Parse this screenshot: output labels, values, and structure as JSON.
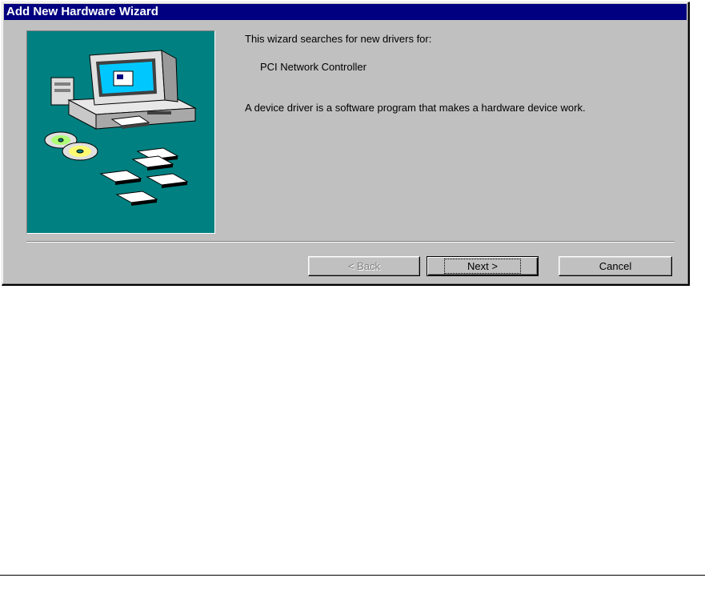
{
  "window": {
    "title": "Add New Hardware Wizard"
  },
  "content": {
    "intro": "This wizard searches for new drivers for:",
    "device_name": "PCI Network Controller",
    "description": "A device driver is a software program that makes a hardware device work."
  },
  "buttons": {
    "back_label": "< Back",
    "next_label": "Next >",
    "cancel_label": "Cancel"
  },
  "colors": {
    "titlebar": "#000080",
    "panel_background": "#008080",
    "dialog_background": "#c0c0c0"
  },
  "illustration": {
    "icons": [
      "computer-icon",
      "cd-rom-disc-icon",
      "floppy-disk-icon"
    ]
  }
}
